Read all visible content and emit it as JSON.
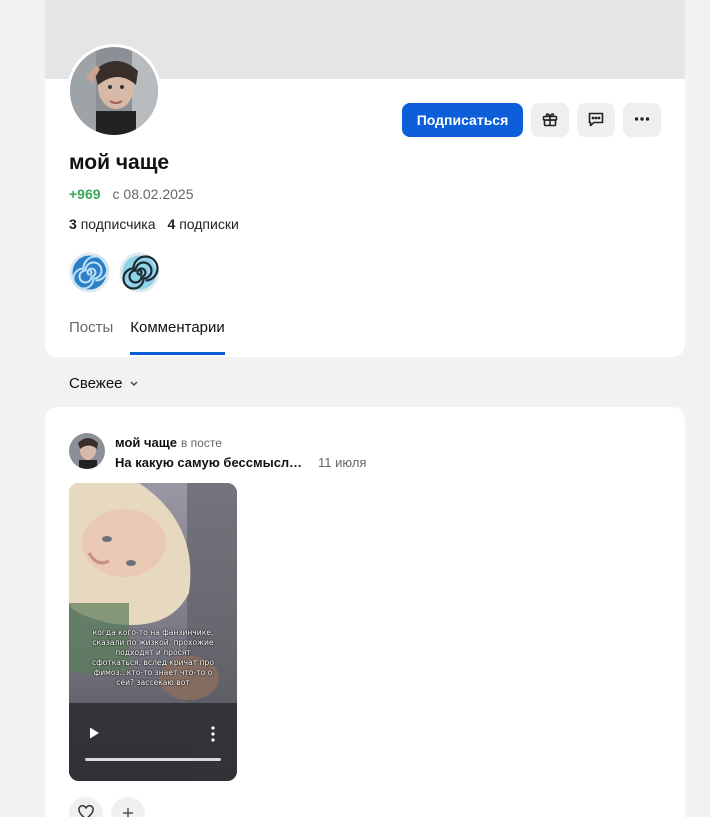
{
  "profile": {
    "name": "мой чаще",
    "karma": "+969",
    "since": "с 08.02.2025",
    "followers_count": "3",
    "followers_label": "подписчика",
    "following_count": "4",
    "following_label": "подписки",
    "avatar_icon": "user-avatar",
    "badges": [
      {
        "icon": "spiral-badge-icon"
      },
      {
        "icon": "spiral-badge-icon"
      }
    ]
  },
  "actions": {
    "subscribe_label": "Подписаться",
    "gift_icon": "gift-icon",
    "message_icon": "message-icon",
    "more_icon": "more-icon"
  },
  "tabs": [
    {
      "label": "Посты",
      "active": false
    },
    {
      "label": "Комментарии",
      "active": true
    }
  ],
  "sort": {
    "label": "Свежее",
    "icon": "chevron-down-icon"
  },
  "comment": {
    "author": "мой чаще",
    "context": "в посте",
    "post_title": "На какую самую бессмыслен…",
    "date": "11 июля",
    "video": {
      "caption": "когда кого-то на фанзинчике, сказали по жизкой. прохожие подходят и просят сфоткаться. вслед кричат про фимоз.. кто-то знает что-то о сёи? зассекаю вот"
    },
    "like_icon": "heart-icon",
    "add_icon": "plus-icon"
  },
  "colors": {
    "accent": "#0c5fd9",
    "karma": "#3aa85a",
    "background": "#f2f2f2"
  }
}
